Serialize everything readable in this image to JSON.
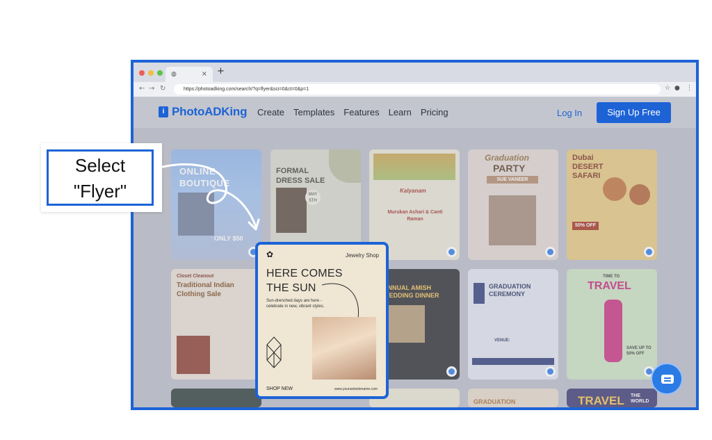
{
  "callout": {
    "line1": "Select",
    "line2": "\"Flyer\""
  },
  "browser": {
    "url": "https://photoadking.com/search/?q=flyer&sci=0&ct=0&p=1",
    "new_tab": "+",
    "tab_close": "×"
  },
  "site": {
    "logo": "PhotoADKing",
    "nav": [
      "Create",
      "Templates",
      "Features",
      "Learn",
      "Pricing"
    ],
    "login": "Log In",
    "signup": "Sign Up Free"
  },
  "cards": {
    "c1": {
      "title": "ONLINE BOUTIQUE",
      "price": "ONLY $50"
    },
    "c2": {
      "title": "FORMAL DRESS SALE",
      "date": "MAY 5TH"
    },
    "c3": {
      "title": "Kalyanam",
      "names": "Murukan Achari & Canti Raman"
    },
    "c4": {
      "title": "Graduation",
      "sub": "PARTY",
      "name": "SUE VANEER"
    },
    "c5": {
      "title": "Dubai DESERT SAFARI",
      "offer": "50% OFF"
    },
    "c6": {
      "tag": "Closet Cleanout",
      "title": "Traditional Indian Clothing Sale"
    },
    "c7": {
      "title": "ANNUAL AMISH WEDDING DINNER"
    },
    "c8": {
      "title": "GRADUATION CEREMONY",
      "venue": "VENUE:"
    },
    "c9": {
      "title": "TRAVEL",
      "sub": "TIME TO",
      "save": "SAVE UP TO 50% OFF"
    },
    "r3a": {
      "title": "GRADUATION"
    },
    "r3b": {
      "title": "TRAVEL",
      "sub": "THE WORLD"
    }
  },
  "featured": {
    "brand": "Jewelry Shop",
    "headline": "HERE COMES THE SUN",
    "sub": "Sun-drenched days are here - celebrate in new, vibrant styles.",
    "cta": "SHOP NEW",
    "site": "www.yourwebsitename.com"
  },
  "colors": {
    "accent": "#1d63d6",
    "overlay": "#b9bcc6"
  }
}
